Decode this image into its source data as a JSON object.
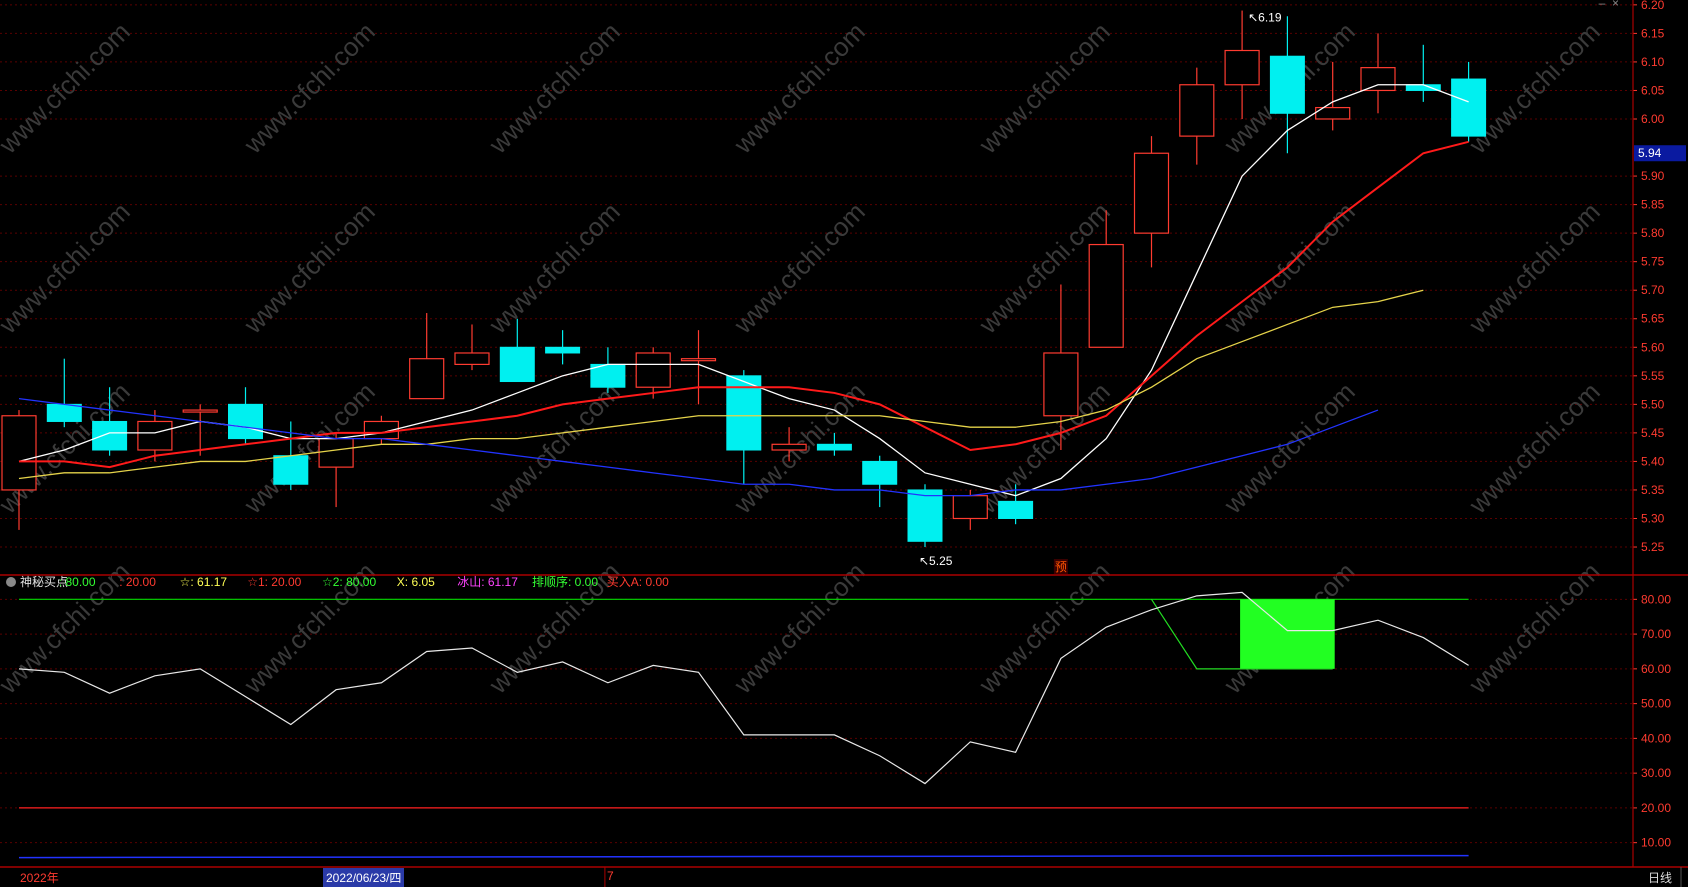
{
  "header": {
    "title_partial": "... (…) ...",
    "window_controls": [
      "minimize-icon",
      "close-icon"
    ]
  },
  "chart_data": [
    {
      "type": "candlestick",
      "panel": "main",
      "price_axis_ticks": [
        "6.20",
        "6.15",
        "6.10",
        "6.05",
        "6.00",
        "5.90",
        "5.85",
        "5.80",
        "5.75",
        "5.70",
        "5.65",
        "5.60",
        "5.55",
        "5.50",
        "5.45",
        "5.40",
        "5.35",
        "5.30",
        "5.25"
      ],
      "ylim": [
        5.215,
        6.205
      ],
      "current_price_label": "5.94",
      "high_marker": "6.19",
      "low_marker": "5.25",
      "candles": [
        {
          "o": 5.35,
          "c": 5.48,
          "h": 5.49,
          "l": 5.28
        },
        {
          "o": 5.5,
          "c": 5.47,
          "h": 5.58,
          "l": 5.46
        },
        {
          "o": 5.47,
          "c": 5.42,
          "h": 5.53,
          "l": 5.41
        },
        {
          "o": 5.42,
          "c": 5.47,
          "h": 5.49,
          "l": 5.4
        },
        {
          "o": 5.49,
          "c": 5.49,
          "h": 5.5,
          "l": 5.41
        },
        {
          "o": 5.5,
          "c": 5.44,
          "h": 5.53,
          "l": 5.43
        },
        {
          "o": 5.41,
          "c": 5.36,
          "h": 5.47,
          "l": 5.35
        },
        {
          "o": 5.39,
          "c": 5.44,
          "h": 5.45,
          "l": 5.32
        },
        {
          "o": 5.44,
          "c": 5.47,
          "h": 5.48,
          "l": 5.43
        },
        {
          "o": 5.51,
          "c": 5.58,
          "h": 5.66,
          "l": 5.51
        },
        {
          "o": 5.57,
          "c": 5.59,
          "h": 5.64,
          "l": 5.56
        },
        {
          "o": 5.6,
          "c": 5.54,
          "h": 5.65,
          "l": 5.54
        },
        {
          "o": 5.6,
          "c": 5.59,
          "h": 5.63,
          "l": 5.57
        },
        {
          "o": 5.57,
          "c": 5.53,
          "h": 5.6,
          "l": 5.52
        },
        {
          "o": 5.53,
          "c": 5.59,
          "h": 5.6,
          "l": 5.51
        },
        {
          "o": 5.58,
          "c": 5.58,
          "h": 5.63,
          "l": 5.5
        },
        {
          "o": 5.55,
          "c": 5.42,
          "h": 5.56,
          "l": 5.36
        },
        {
          "o": 5.42,
          "c": 5.43,
          "h": 5.46,
          "l": 5.4
        },
        {
          "o": 5.43,
          "c": 5.42,
          "h": 5.45,
          "l": 5.41
        },
        {
          "o": 5.4,
          "c": 5.36,
          "h": 5.41,
          "l": 5.32
        },
        {
          "o": 5.35,
          "c": 5.26,
          "h": 5.36,
          "l": 5.25
        },
        {
          "o": 5.3,
          "c": 5.34,
          "h": 5.35,
          "l": 5.28
        },
        {
          "o": 5.33,
          "c": 5.3,
          "h": 5.36,
          "l": 5.29
        },
        {
          "o": 5.48,
          "c": 5.59,
          "h": 5.71,
          "l": 5.42
        },
        {
          "o": 5.6,
          "c": 5.78,
          "h": 5.84,
          "l": 5.6
        },
        {
          "o": 5.8,
          "c": 5.94,
          "h": 5.97,
          "l": 5.74
        },
        {
          "o": 5.97,
          "c": 6.06,
          "h": 6.09,
          "l": 5.92
        },
        {
          "o": 6.06,
          "c": 6.12,
          "h": 6.19,
          "l": 6.0
        },
        {
          "o": 6.11,
          "c": 6.01,
          "h": 6.18,
          "l": 5.94
        },
        {
          "o": 6.0,
          "c": 6.02,
          "h": 6.1,
          "l": 5.98
        },
        {
          "o": 6.05,
          "c": 6.09,
          "h": 6.15,
          "l": 6.01
        },
        {
          "o": 6.06,
          "c": 6.05,
          "h": 6.13,
          "l": 6.03
        },
        {
          "o": 6.07,
          "c": 5.97,
          "h": 6.1,
          "l": 5.96
        }
      ],
      "moving_averages": [
        {
          "color": "#ffffff",
          "values": [
            5.4,
            5.42,
            5.45,
            5.45,
            5.47,
            5.46,
            5.44,
            5.44,
            5.45,
            5.47,
            5.49,
            5.52,
            5.55,
            5.57,
            5.57,
            5.57,
            5.54,
            5.51,
            5.49,
            5.44,
            5.38,
            5.36,
            5.34,
            5.37,
            5.44,
            5.56,
            5.73,
            5.9,
            5.98,
            6.03,
            6.06,
            6.06,
            6.03
          ]
        },
        {
          "color": "#ff1a1a",
          "values": [
            5.4,
            5.4,
            5.39,
            5.41,
            5.42,
            5.43,
            5.44,
            5.45,
            5.45,
            5.46,
            5.47,
            5.48,
            5.5,
            5.51,
            5.52,
            5.53,
            5.53,
            5.53,
            5.52,
            5.5,
            5.46,
            5.42,
            5.43,
            5.45,
            5.48,
            5.55,
            5.62,
            5.68,
            5.74,
            5.82,
            5.88,
            5.94,
            5.96
          ]
        },
        {
          "color": "#e5d34a",
          "values": [
            5.37,
            5.38,
            5.38,
            5.39,
            5.4,
            5.4,
            5.41,
            5.42,
            5.43,
            5.43,
            5.44,
            5.44,
            5.45,
            5.46,
            5.47,
            5.48,
            5.48,
            5.48,
            5.48,
            5.48,
            5.47,
            5.46,
            5.46,
            5.47,
            5.49,
            5.53,
            5.58,
            5.61,
            5.64,
            5.67,
            5.68,
            5.7
          ]
        },
        {
          "color": "#2233ff",
          "values": [
            5.51,
            5.5,
            5.49,
            5.48,
            5.47,
            5.46,
            5.45,
            5.44,
            5.44,
            5.43,
            5.42,
            5.41,
            5.4,
            5.39,
            5.38,
            5.37,
            5.36,
            5.36,
            5.35,
            5.35,
            5.34,
            5.34,
            5.35,
            5.35,
            5.36,
            5.37,
            5.39,
            5.41,
            5.43,
            5.46,
            5.49
          ]
        }
      ]
    },
    {
      "type": "line",
      "panel": "indicator",
      "name": "神秘买点",
      "legend": [
        {
          "text": "神秘买点",
          "color": "#e0e0e0"
        },
        {
          "text": ": 80.00",
          "color": "#33ff33"
        },
        {
          "text": ": 20.00",
          "color": "#ff3b30"
        },
        {
          "text": "☆: 61.17",
          "color": "#ffff55"
        },
        {
          "text": "☆1: 20.00",
          "color": "#ff3b30"
        },
        {
          "text": "☆2: 80.00",
          "color": "#33ff33"
        },
        {
          "text": "X: 6.05",
          "color": "#ffff55"
        },
        {
          "text": "冰山: 61.17",
          "color": "#ff44ff"
        },
        {
          "text": "排顺序: 0.00",
          "color": "#33ff33"
        },
        {
          "text": "买入A: 0.00",
          "color": "#ff3b30"
        }
      ],
      "axis_ticks": [
        "80.00",
        "70.00",
        "60.00",
        "50.00",
        "40.00",
        "30.00",
        "20.00",
        "10.00"
      ],
      "ylim": [
        3,
        87
      ],
      "reference_lines": [
        {
          "value": 80,
          "color": "#00dd00"
        },
        {
          "value": 20,
          "color": "#ff2020"
        }
      ],
      "white_line": [
        60,
        59,
        53,
        58,
        60,
        52,
        44,
        54,
        56,
        65,
        66,
        59,
        62,
        56,
        61,
        59,
        41,
        41,
        41,
        35,
        27,
        39,
        36,
        63,
        72,
        77,
        81,
        82,
        71,
        71,
        74,
        69,
        61
      ],
      "green_line": {
        "from_index": 25,
        "values": [
          80,
          60,
          60,
          60,
          60
        ]
      },
      "signal_block": {
        "from": 27,
        "to": 29,
        "top": 80,
        "bottom": 60,
        "color": "#22ff22"
      },
      "blue_line_value": 6
    }
  ],
  "bottom_bar": {
    "year_label": "2022年",
    "date_label": "2022/06/23/四",
    "month_marker": "7",
    "period_label": "日线"
  },
  "watermark": "www.cfchi.com",
  "yu_marker": "预"
}
